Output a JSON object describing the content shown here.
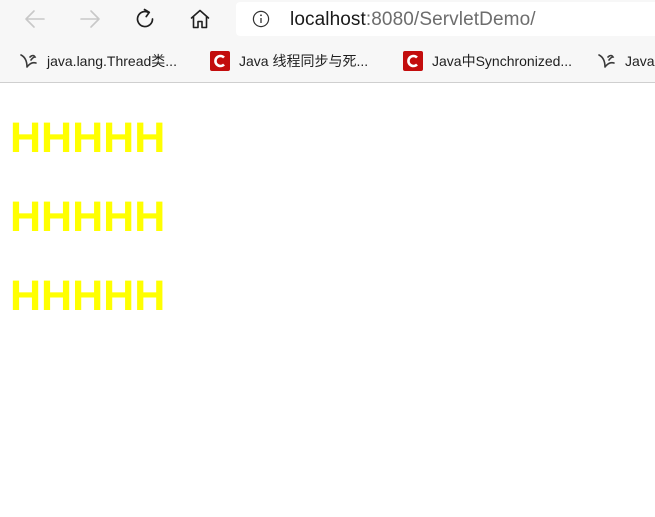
{
  "browser": {
    "address_bar": {
      "url_host": "localhost",
      "url_rest": ":8080/ServletDemo/"
    },
    "nav": {
      "back_icon": "arrow-left-icon",
      "forward_icon": "arrow-right-icon",
      "refresh_icon": "refresh-icon",
      "home_icon": "home-icon",
      "info_icon": "info-icon"
    },
    "bookmarks": [
      {
        "label": "java.lang.Thread类...",
        "icon": "bird-icon"
      },
      {
        "label": "Java 线程同步与死...",
        "icon": "csdn-icon"
      },
      {
        "label": "Java中Synchronized...",
        "icon": "csdn-icon"
      },
      {
        "label": "Java线",
        "icon": "bird-icon"
      }
    ],
    "colors": {
      "chrome_bg": "#f7f7f7",
      "csdn_red": "#c30d0d"
    }
  },
  "page": {
    "headings": [
      "HHHHH",
      "HHHHH",
      "HHHHH"
    ],
    "heading_color": "#ffff00"
  }
}
